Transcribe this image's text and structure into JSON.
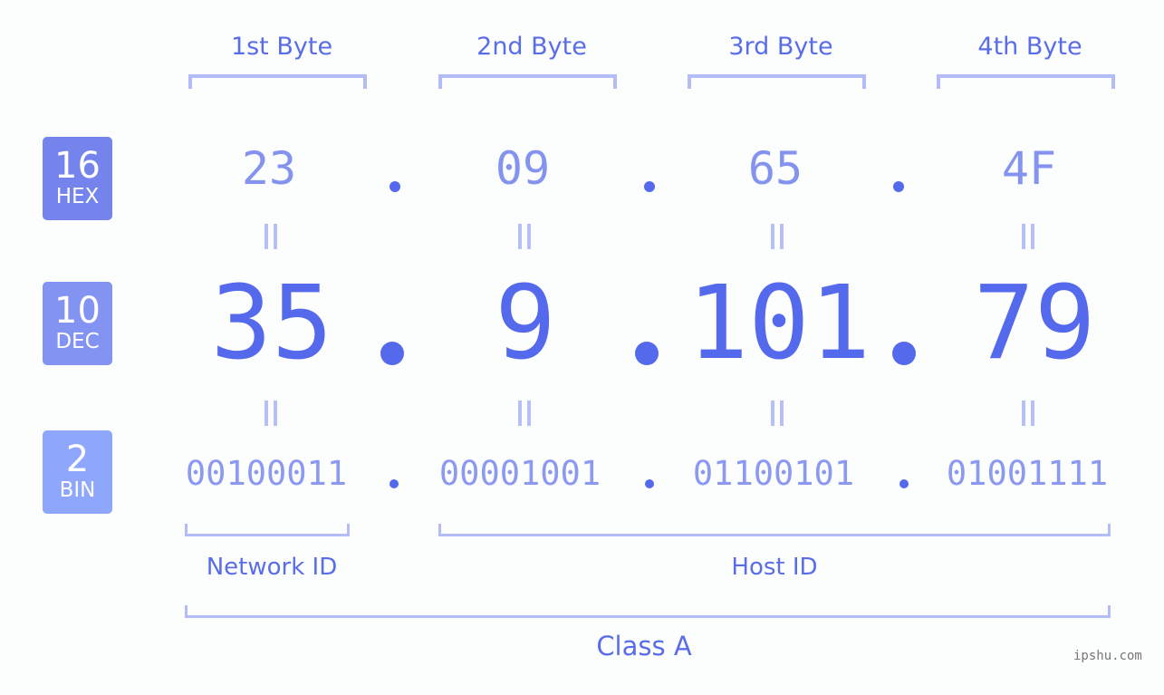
{
  "ip": {
    "bytes": [
      {
        "title": "1st Byte",
        "hex": "23",
        "dec": "35",
        "bin": "00100011"
      },
      {
        "title": "2nd Byte",
        "hex": "09",
        "dec": "9",
        "bin": "00001001"
      },
      {
        "title": "3rd Byte",
        "hex": "65",
        "dec": "101",
        "bin": "01100101"
      },
      {
        "title": "4th Byte",
        "hex": "4F",
        "dec": "79",
        "bin": "01001111"
      }
    ],
    "separator": "."
  },
  "badges": {
    "hex": {
      "base": "16",
      "label": "HEX",
      "color": "#7584ec"
    },
    "dec": {
      "base": "10",
      "label": "DEC",
      "color": "#8393f2"
    },
    "bin": {
      "base": "2",
      "label": "BIN",
      "color": "#8ea7fb"
    }
  },
  "sections": {
    "network": "Network ID",
    "host": "Host ID",
    "class": "Class A"
  },
  "watermark": "ipshu.com",
  "colors": {
    "accent": "#5569ec",
    "bracket": "#b3bcf7",
    "hex_text": "#8493ef",
    "bin_text": "#8c99f0"
  }
}
